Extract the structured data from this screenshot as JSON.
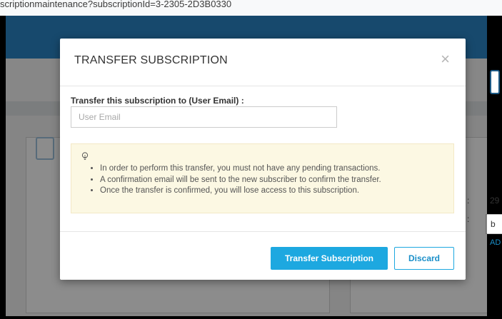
{
  "browser": {
    "address_text": "scriptionmaintenance?subscriptionId=3-2305-2D3B0330"
  },
  "background": {
    "value_29": "29",
    "value_b": "b",
    "link_ad": "AD"
  },
  "modal": {
    "title": "TRANSFER SUBSCRIPTION",
    "close_glyph": "×",
    "field_label": "Transfer this subscription to (User Email) :",
    "email_placeholder": "User Email",
    "email_value": "",
    "notice_items": [
      "In order to perform this transfer, you must not have any pending transactions.",
      "A confirmation email will be sent to the new subscriber to confirm the transfer.",
      "Once the transfer is confirmed, you will lose access to this subscription."
    ],
    "primary_button": "Transfer Subscription",
    "secondary_button": "Discard"
  },
  "icons": {
    "notice": "lightbulb-icon",
    "close": "close-icon"
  },
  "colors": {
    "header_blue": "#2a85c6",
    "primary_button": "#1da8e0",
    "notice_bg": "#fcf8e3"
  }
}
